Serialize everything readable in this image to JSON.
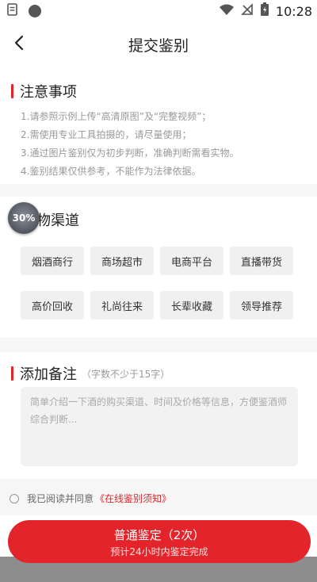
{
  "status_bar": {
    "time": "10:28"
  },
  "header": {
    "title": "提交鉴别"
  },
  "notice": {
    "title": "注意事项",
    "items": [
      "1.请参照示例上传“高清原图”及“完整视频”；",
      "2.需使用专业工具拍摄的，请尽量使用；",
      "3.通过图片鉴别仅为初步判断，准确判断需看实物。",
      "4.鉴别结果仅供参考，不能作为法律依据。"
    ]
  },
  "channel": {
    "title": "物渠道",
    "badge": "30%",
    "options": [
      "烟酒商行",
      "商场超市",
      "电商平台",
      "直播带货",
      "高价回收",
      "礼尚往来",
      "长辈收藏",
      "领导推荐"
    ]
  },
  "remark": {
    "title": "添加备注",
    "hint": "（字数不少于15字）",
    "placeholder": "简单介绍一下酒的购买渠道、时间及价格等信息，方便鉴酒师综合判断..."
  },
  "agreement": {
    "text": "我已阅读并同意",
    "link": "《在线鉴别须知》"
  },
  "submit": {
    "label": "普通鉴定（2次）",
    "sub": "预计24小时内鉴定完成"
  },
  "colors": {
    "accent": "#e0252b",
    "chip_bg": "#f0f0f0"
  }
}
